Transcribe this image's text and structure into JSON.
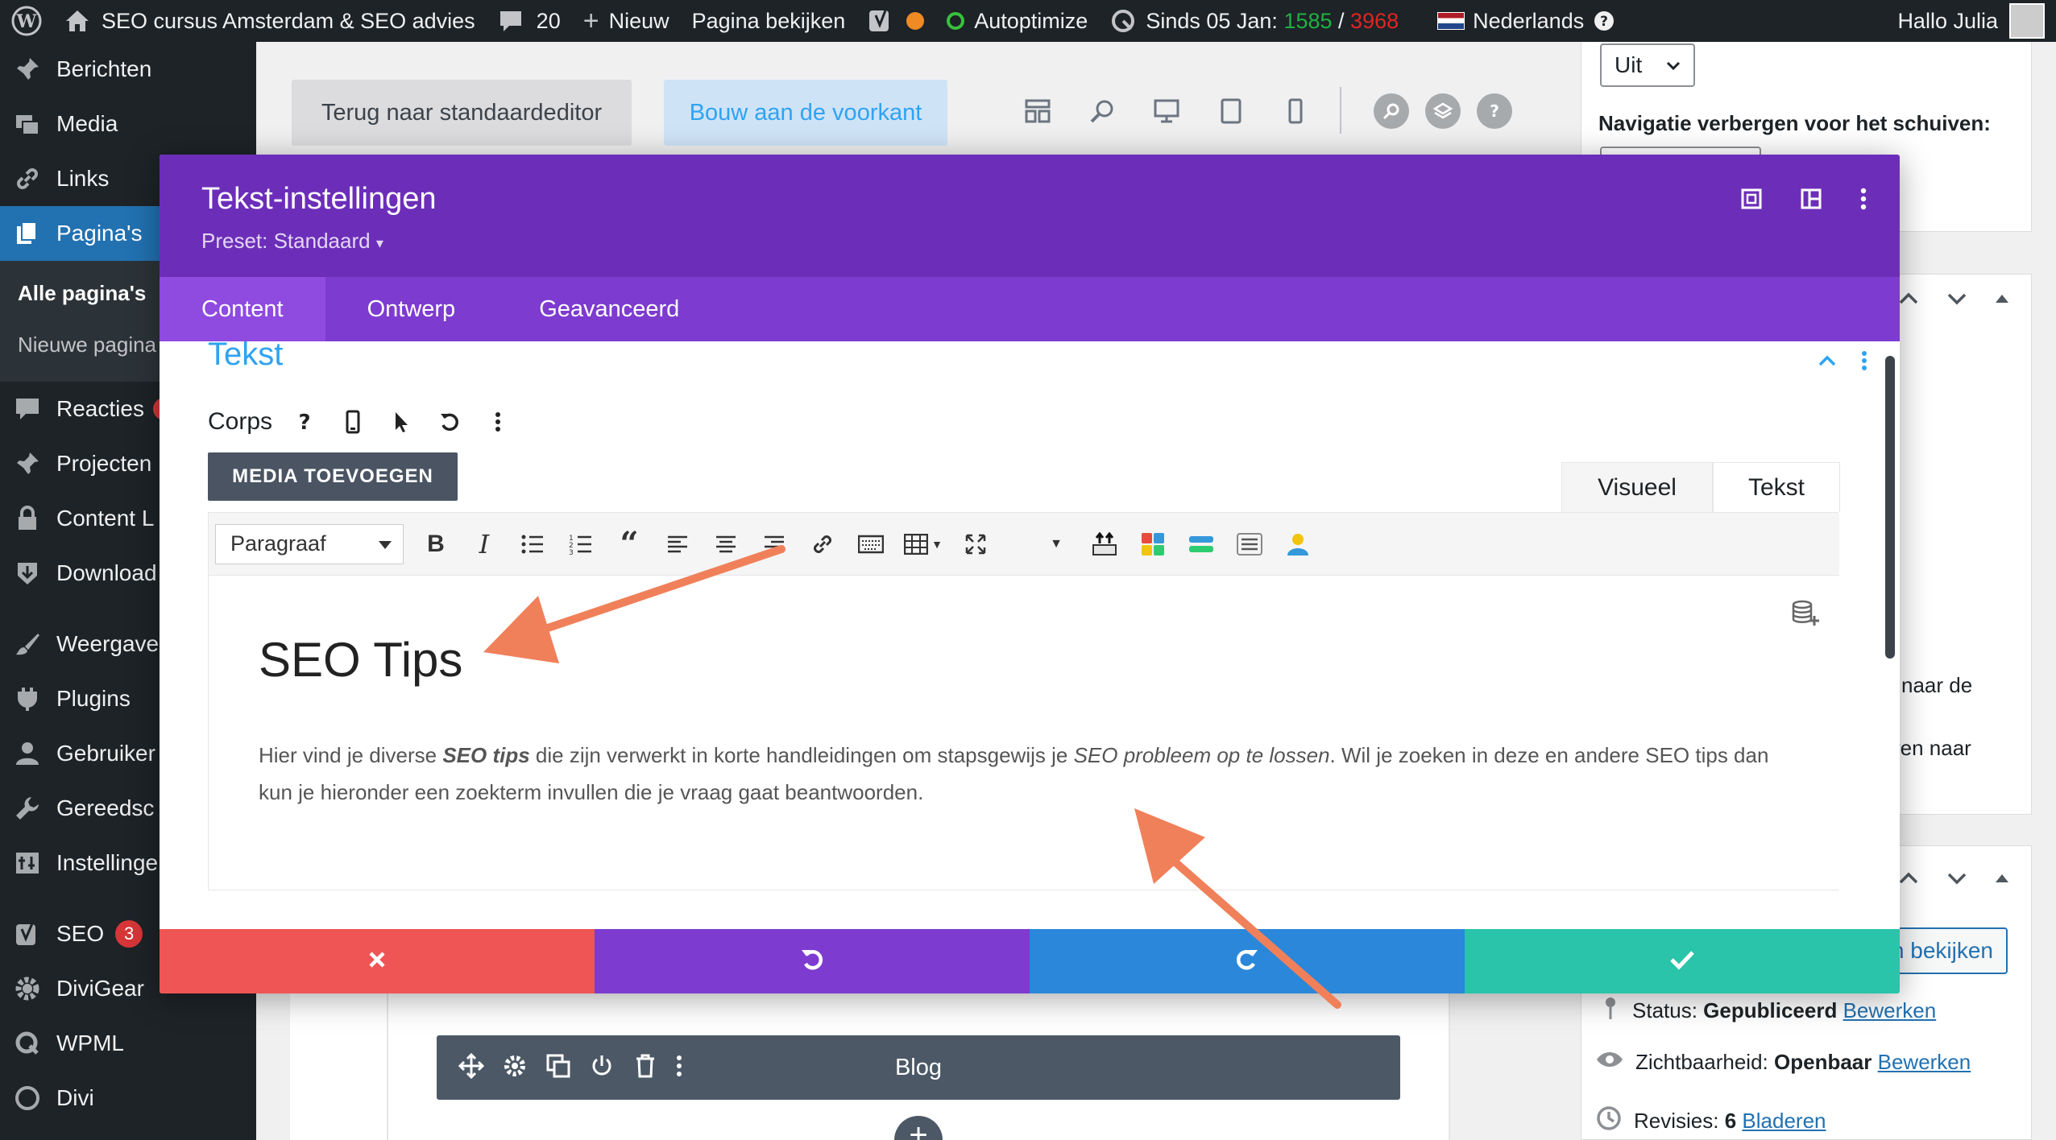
{
  "adminbar": {
    "site_name": "SEO cursus Amsterdam & SEO advies",
    "comments_count": "20",
    "new_label": "Nieuw",
    "view_page": "Pagina bekijken",
    "autoptimize": "Autoptimize",
    "since_label": "Sinds 05 Jan:",
    "since_green": "1585",
    "since_sep": " / ",
    "since_red": "3968",
    "language": "Nederlands",
    "greeting": "Hallo Julia"
  },
  "sidebar": {
    "items": [
      {
        "label": "Berichten",
        "icon": "pin-icon"
      },
      {
        "label": "Media",
        "icon": "media-icon"
      },
      {
        "label": "Links",
        "icon": "link-icon"
      },
      {
        "label": "Pagina's",
        "icon": "pages-icon"
      },
      {
        "label": "Reacties",
        "icon": "comment-icon"
      },
      {
        "label": "Projecten",
        "icon": "pin-icon"
      },
      {
        "label": "Content L",
        "icon": "lock-icon"
      },
      {
        "label": "Download",
        "icon": "download-icon"
      },
      {
        "label": "Weergave",
        "icon": "brush-icon"
      },
      {
        "label": "Plugins",
        "icon": "plugin-icon"
      },
      {
        "label": "Gebruiker",
        "icon": "user-icon"
      },
      {
        "label": "Gereedsc",
        "icon": "wrench-icon"
      },
      {
        "label": "Instellinge",
        "icon": "settings-icon"
      },
      {
        "label": "SEO",
        "icon": "yoast-icon",
        "badge": "3"
      },
      {
        "label": "DiviGear",
        "icon": "gear-icon"
      },
      {
        "label": "WPML",
        "icon": "wpml-icon"
      },
      {
        "label": "Divi",
        "icon": "divi-icon"
      }
    ],
    "sub": {
      "all_pages": "Alle pagina's",
      "new_page": "Nieuwe pagina"
    }
  },
  "editor": {
    "back_std": "Terug naar standaardeditor",
    "front_build": "Bouw aan de voorkant"
  },
  "right": {
    "select_value": "Uit",
    "nav_hide_label": "Navigatie verbergen voor het schuiven:",
    "frag1": "naar de",
    "frag2": "ren naar",
    "view_btn": "n bekijken",
    "status_label": "Status:",
    "status_value": "Gepubliceerd",
    "visibility_label": "Zichtbaarheid:",
    "visibility_value": "Openbaar",
    "revisions_label": "Revisies:",
    "revisions_value": "6",
    "edit_link": "Bewerken",
    "browse_link": "Bladeren"
  },
  "canvas": {
    "module_label": "Blog"
  },
  "modal": {
    "title": "Tekst-instellingen",
    "preset": "Preset: Standaard",
    "tabs": [
      "Content",
      "Ontwerp",
      "Geavanceerd"
    ],
    "section_title": "Tekst",
    "corps_label": "Corps",
    "media_btn": "MEDIA TOEVOEGEN",
    "tab_visual": "Visueel",
    "tab_text": "Tekst",
    "paragraph_select": "Paragraaf",
    "heading": "SEO Tips",
    "paragraph": {
      "p1": "Hier vind je diverse ",
      "b1": "SEO tips",
      "p2": " die zijn verwerkt in korte handleidingen om stapsgewijs je ",
      "i1": "SEO probleem op te lossen",
      "p3": ". Wil je zoeken in deze en andere SEO tips dan kun je hieronder een zoekterm invullen die je vraag gaat beantwoorden."
    }
  },
  "colors": {
    "modal_header": "#6c2eb9",
    "modal_tabs": "#7d3bcf",
    "cancel": "#ef5555",
    "undo": "#7d3bcf",
    "redo": "#2b87da",
    "save": "#29c4a9",
    "annotation_arrow": "#f0805a"
  }
}
